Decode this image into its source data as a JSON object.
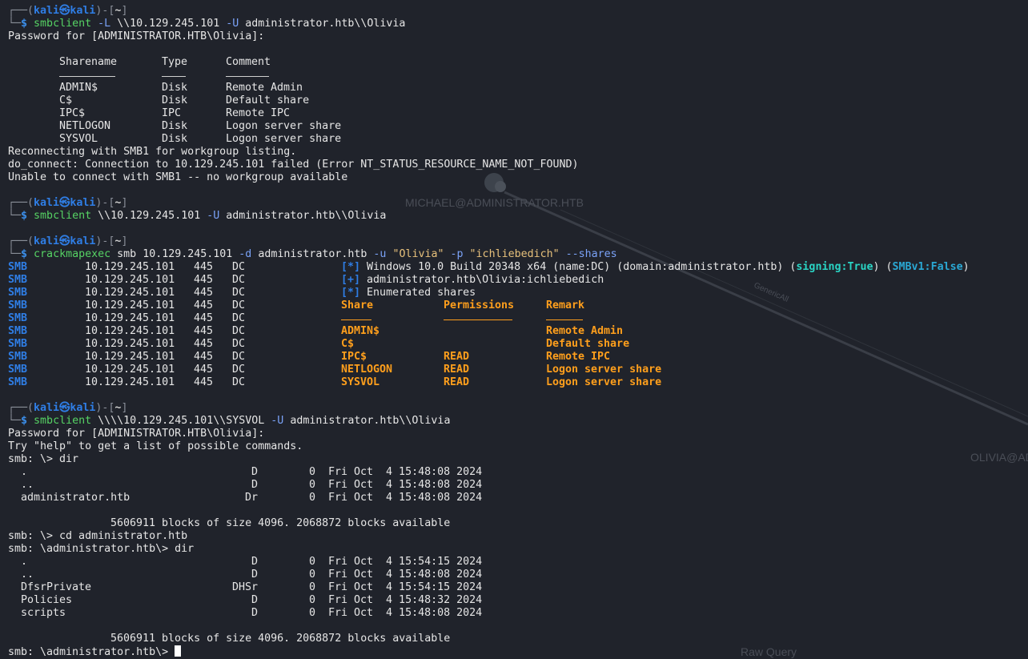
{
  "prompt": {
    "user": "kali",
    "host": "kali",
    "dir": "~",
    "skull": "㉿",
    "top": "┌──(",
    "sep": ")-[",
    "close": "]",
    "bottom": "└─",
    "dollar": "$"
  },
  "bg": {
    "labels": [
      "MICHAEL@ADMINISTRATOR.HTB",
      "GenericAll",
      "OLIVIA@AD",
      "Raw Query"
    ],
    "color": "#4a4e57"
  },
  "block1": {
    "cmd": "smbclient",
    "opt_L": "-L",
    "target": "\\\\10.129.245.101",
    "opt_U": "-U",
    "user": "administrator.htb\\\\Olivia",
    "pwd_prompt": "Password for [ADMINISTRATOR.HTB\\Olivia]:",
    "headers": [
      "Sharename",
      "Type",
      "Comment"
    ],
    "rows": [
      [
        "ADMIN$",
        "Disk",
        "Remote Admin"
      ],
      [
        "C$",
        "Disk",
        "Default share"
      ],
      [
        "IPC$",
        "IPC",
        "Remote IPC"
      ],
      [
        "NETLOGON",
        "Disk",
        "Logon server share"
      ],
      [
        "SYSVOL",
        "Disk",
        "Logon server share"
      ]
    ],
    "msgs": [
      "Reconnecting with SMB1 for workgroup listing.",
      "do_connect: Connection to 10.129.245.101 failed (Error NT_STATUS_RESOURCE_NAME_NOT_FOUND)",
      "Unable to connect with SMB1 -- no workgroup available"
    ]
  },
  "block2": {
    "cmd": "smbclient",
    "target": "\\\\10.129.245.101",
    "opt_U": "-U",
    "user": "administrator.htb\\\\Olivia"
  },
  "block3": {
    "cmd": "crackmapexec",
    "proto": "smb",
    "ip": "10.129.245.101",
    "opt_d": "-d",
    "domain": "administrator.htb",
    "opt_u": "-u",
    "user": "\"Olivia\"",
    "opt_p": "-p",
    "pass": "\"ichliebedich\"",
    "opt_shares": "--shares",
    "col_smb": "SMB",
    "col_ip": "10.129.245.101",
    "col_port": "445",
    "col_dc": "DC",
    "info1_tag": "[*]",
    "info1_text": "Windows 10.0 Build 20348 x64 (name:DC) (domain:administrator.htb) (",
    "signing": "signing:True",
    "mid": ") (",
    "smbv1": "SMBv1:False",
    "end": ")",
    "info2_tag": "[+]",
    "info2_text": "administrator.htb\\Olivia:ichliebedich",
    "info3_tag": "[*]",
    "info3_text": "Enumerated shares",
    "headers": [
      "Share",
      "Permissions",
      "Remark"
    ],
    "rows": [
      [
        "ADMIN$",
        "",
        "Remote Admin"
      ],
      [
        "C$",
        "",
        "Default share"
      ],
      [
        "IPC$",
        "READ",
        "Remote IPC"
      ],
      [
        "NETLOGON",
        "READ",
        "Logon server share"
      ],
      [
        "SYSVOL",
        "READ",
        "Logon server share"
      ]
    ]
  },
  "block4": {
    "cmd": "smbclient",
    "target": "\\\\\\\\10.129.245.101\\\\SYSVOL",
    "opt_U": "-U",
    "user": "administrator.htb\\\\Olivia",
    "pwd_prompt": "Password for [ADMINISTRATOR.HTB\\Olivia]:",
    "help": "Try \"help\" to get a list of possible commands.",
    "p1": "smb: \\> dir",
    "dir1": [
      {
        "name": ".",
        "attr": "D",
        "size": "0",
        "date": "Fri Oct  4 15:48:08 2024"
      },
      {
        "name": "..",
        "attr": "D",
        "size": "0",
        "date": "Fri Oct  4 15:48:08 2024"
      },
      {
        "name": "administrator.htb",
        "attr": "Dr",
        "size": "0",
        "date": "Fri Oct  4 15:48:08 2024"
      }
    ],
    "blocks1": "5606911 blocks of size 4096. 2068872 blocks available",
    "p2": "smb: \\> cd administrator.htb",
    "p3": "smb: \\administrator.htb\\> dir",
    "dir2": [
      {
        "name": ".",
        "attr": "D",
        "size": "0",
        "date": "Fri Oct  4 15:54:15 2024"
      },
      {
        "name": "..",
        "attr": "D",
        "size": "0",
        "date": "Fri Oct  4 15:48:08 2024"
      },
      {
        "name": "DfsrPrivate",
        "attr": "DHSr",
        "size": "0",
        "date": "Fri Oct  4 15:54:15 2024"
      },
      {
        "name": "Policies",
        "attr": "D",
        "size": "0",
        "date": "Fri Oct  4 15:48:32 2024"
      },
      {
        "name": "scripts",
        "attr": "D",
        "size": "0",
        "date": "Fri Oct  4 15:48:08 2024"
      }
    ],
    "blocks2": "5606911 blocks of size 4096. 2068872 blocks available",
    "p4": "smb: \\administrator.htb\\> "
  }
}
